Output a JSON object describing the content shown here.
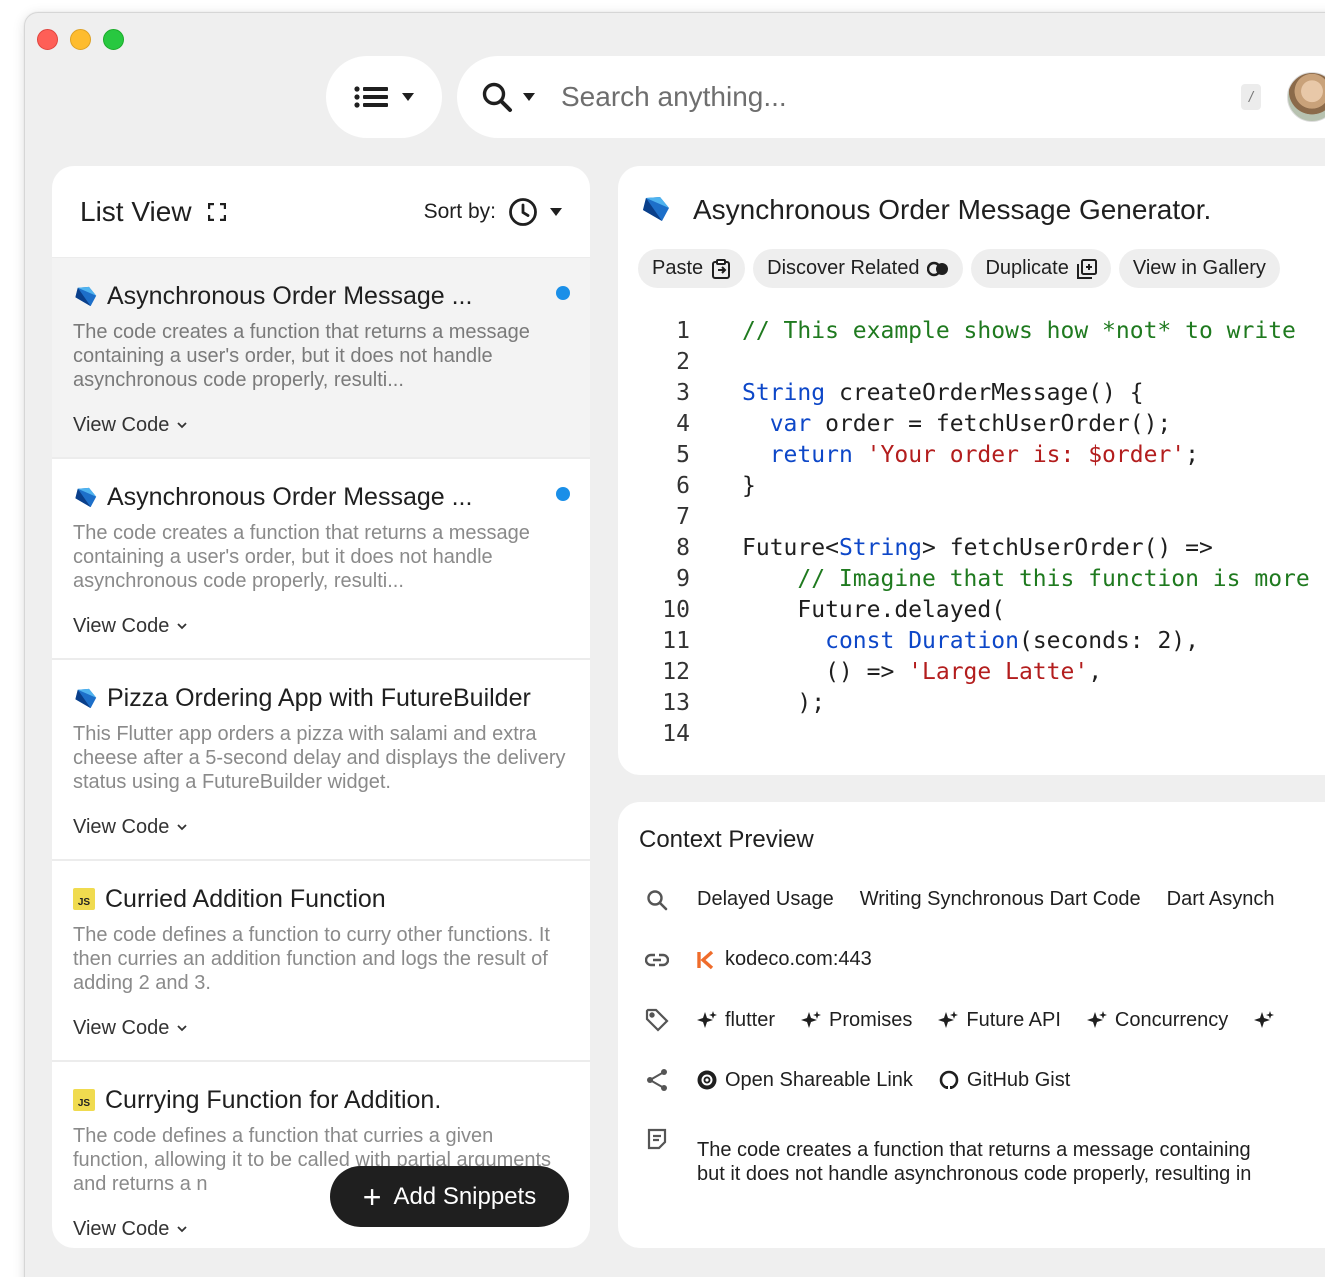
{
  "search": {
    "placeholder": "Search anything...",
    "shortcut": "/"
  },
  "list_view": {
    "title": "List View",
    "sort_label": "Sort by:",
    "add_button_label": "Add Snippets",
    "items": [
      {
        "lang": "dart",
        "title": "Asynchronous Order Message ...",
        "desc": "The code creates a function that returns a message containing a user's order, but it does not handle asynchronous code properly, resulti...",
        "view_label": "View Code",
        "active": true,
        "unread": true
      },
      {
        "lang": "dart",
        "title": "Asynchronous Order Message ...",
        "desc": "The code creates a function that returns a message containing a user's order, but it does not handle asynchronous code properly, resulti...",
        "view_label": "View Code",
        "active": false,
        "unread": true
      },
      {
        "lang": "dart",
        "title": "Pizza Ordering App with FutureBuilder",
        "desc": "This Flutter app orders a pizza with salami and extra cheese after a 5-second delay and displays the delivery status using a FutureBuilder widget.",
        "view_label": "View Code",
        "active": false,
        "unread": false
      },
      {
        "lang": "js",
        "title": "Curried Addition Function",
        "desc": "The code defines a function to curry other functions. It then curries an addition function and logs the result of adding 2 and 3.",
        "view_label": "View Code",
        "active": false,
        "unread": false
      },
      {
        "lang": "js",
        "title": "Currying Function for Addition.",
        "desc": "The code defines a function that curries a given function, allowing it to be called with partial arguments and returns a n",
        "view_label": "View Code",
        "active": false,
        "unread": false
      }
    ]
  },
  "detail": {
    "title": "Asynchronous Order Message Generator.",
    "actions": [
      "Paste",
      "Discover Related",
      "Duplicate",
      "View in Gallery"
    ],
    "code_lines": [
      "// This example shows how *not* to write",
      "",
      "String createOrderMessage() {",
      "  var order = fetchUserOrder();",
      "  return 'Your order is: $order';",
      "}",
      "",
      "Future<String> fetchUserOrder() =>",
      "    // Imagine that this function is more",
      "    Future.delayed(",
      "      const Duration(seconds: 2),",
      "      () => 'Large Latte',",
      "    );",
      ""
    ]
  },
  "context": {
    "title": "Context Preview",
    "related": [
      "Delayed Usage",
      "Writing Synchronous Dart Code",
      "Dart Asynch"
    ],
    "source": "kodeco.com:443",
    "tags": [
      "flutter",
      "Promises",
      "Future API",
      "Concurrency"
    ],
    "share": [
      "Open Shareable Link",
      "GitHub Gist"
    ],
    "description_lines": [
      "The code creates a function that returns a message containing",
      "but it does not handle asynchronous code properly, resulting in"
    ]
  },
  "colors": {
    "accent_dot": "#1a8fe8",
    "dart_blue": "#1d6fc9",
    "js_yellow": "#f0db4f",
    "kodeco_orange": "#ef6c2b"
  }
}
